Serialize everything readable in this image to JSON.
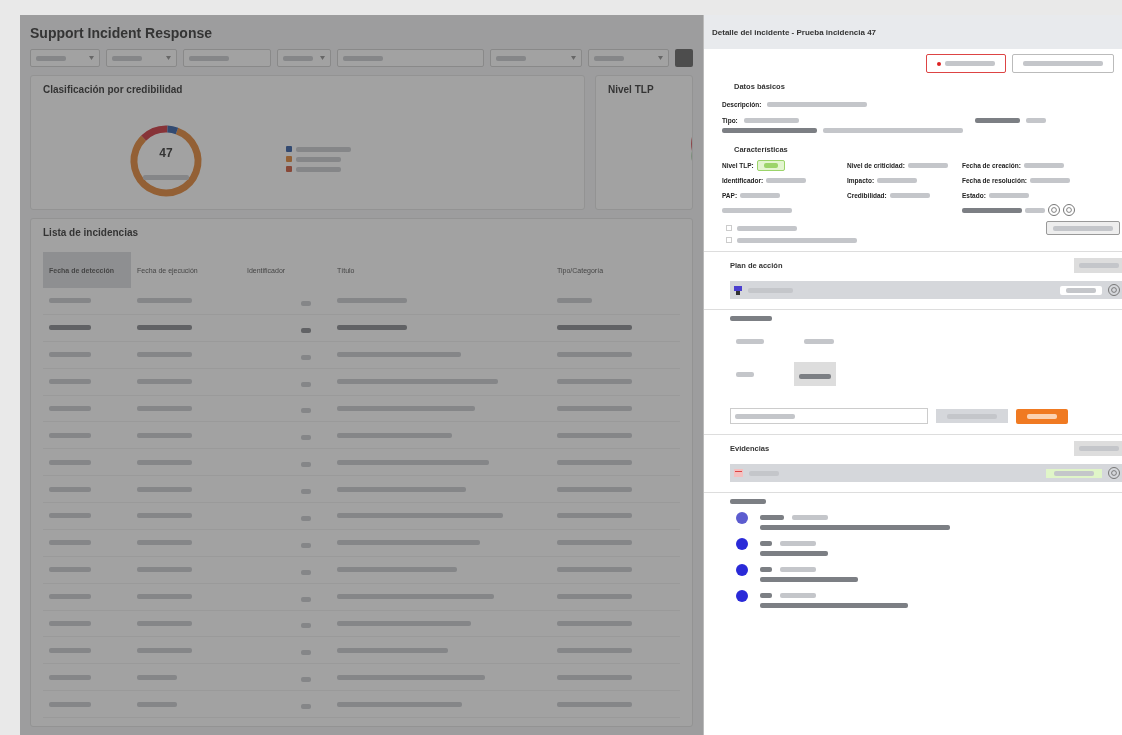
{
  "app": {
    "title": "Support Incident Response"
  },
  "filters": [
    {
      "kind": "dropdown"
    },
    {
      "kind": "dropdown"
    },
    {
      "kind": "text"
    },
    {
      "kind": "dropdown"
    },
    {
      "kind": "text"
    },
    {
      "kind": "dropdown"
    },
    {
      "kind": "dropdown"
    },
    {
      "kind": "button"
    }
  ],
  "charts": [
    {
      "title": "Clasificación por credibilidad",
      "total": "47",
      "legend": [
        {
          "color": "#334a71"
        },
        {
          "color": "#936035"
        },
        {
          "color": "#874838"
        }
      ]
    },
    {
      "title": "Nivel TLP"
    }
  ],
  "table": {
    "title": "Lista de incidencias",
    "columns": [
      {
        "label": "Fecha de detección",
        "selected": true
      },
      {
        "label": "Fecha de ejecución",
        "selected": false
      },
      {
        "label": "Identificador",
        "selected": false
      },
      {
        "label": "Título",
        "selected": false
      },
      {
        "label": "Tipo/Categoría",
        "selected": false
      }
    ],
    "rows": [
      {
        "selected": false
      },
      {
        "selected": true
      },
      {
        "selected": false
      },
      {
        "selected": false
      },
      {
        "selected": false
      },
      {
        "selected": false
      },
      {
        "selected": false
      },
      {
        "selected": false
      },
      {
        "selected": false
      },
      {
        "selected": false
      },
      {
        "selected": false
      },
      {
        "selected": false
      },
      {
        "selected": false
      },
      {
        "selected": false
      },
      {
        "selected": false
      },
      {
        "selected": false
      }
    ]
  },
  "drawer": {
    "title": "Detalle del incidente - Prueba incidencia 47",
    "basic_title": "Datos básicos",
    "description_label": "Descripción:",
    "type_label": "Tipo:",
    "features_title": "Características",
    "features": [
      {
        "label": "Nivel TLP:",
        "kind": "tag"
      },
      {
        "label": "Nivel de criticidad:",
        "kind": "text"
      },
      {
        "label": "Fecha de creación:",
        "kind": "text"
      },
      {
        "label": "Identificador:",
        "kind": "text"
      },
      {
        "label": "Impacto:",
        "kind": "text"
      },
      {
        "label": "Fecha de resolución:",
        "kind": "text"
      },
      {
        "label": "PAP:",
        "kind": "text"
      },
      {
        "label": "Credibilidad:",
        "kind": "text"
      },
      {
        "label": "Estado:",
        "kind": "text"
      }
    ],
    "plan_title": "Plan de acción",
    "evidence_title": "Evidencias",
    "activity": [
      {
        "kind": "system"
      },
      {
        "kind": "user"
      },
      {
        "kind": "user"
      },
      {
        "kind": "user"
      }
    ]
  }
}
